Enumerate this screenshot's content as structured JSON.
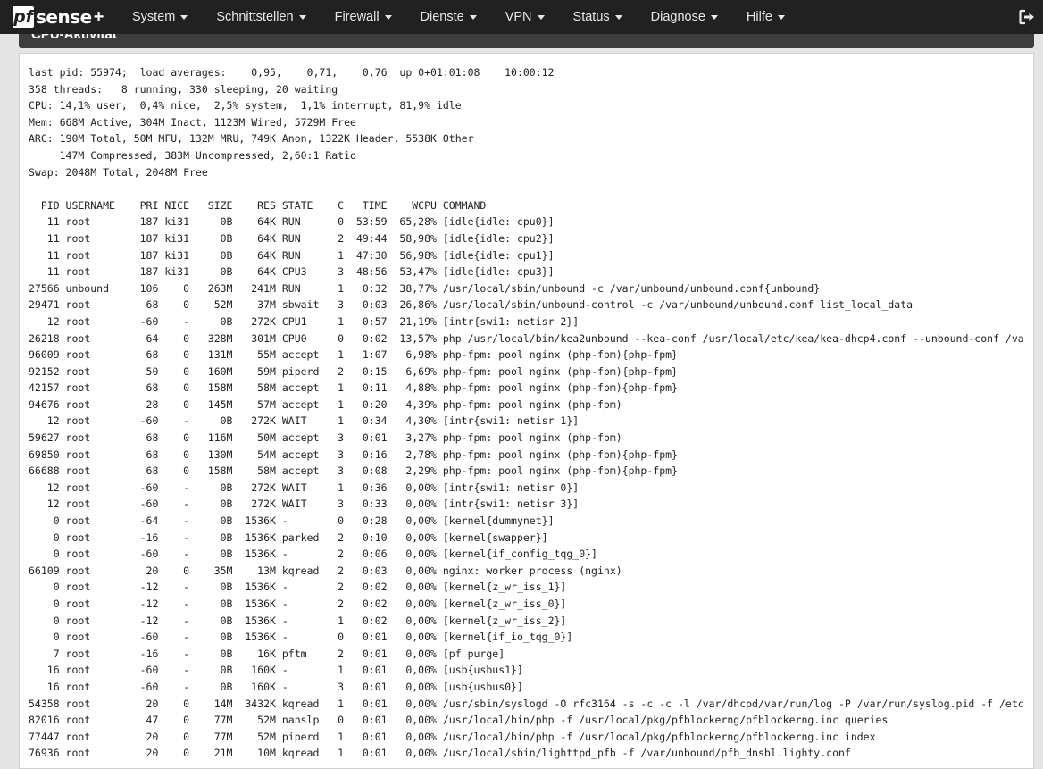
{
  "navbar": {
    "logo_mark": "pf",
    "logo_text": "sense",
    "logo_plus": "+",
    "menu": [
      "System",
      "Schnittstellen",
      "Firewall",
      "Dienste",
      "VPN",
      "Status",
      "Diagnose",
      "Hilfe"
    ]
  },
  "panel": {
    "title": "CPU-Aktivität"
  },
  "top_output": {
    "lines": [
      "last pid: 55974;  load averages:    0,95,    0,71,    0,76  up 0+01:01:08    10:00:12",
      "358 threads:   8 running, 330 sleeping, 20 waiting",
      "CPU: 14,1% user,  0,4% nice,  2,5% system,  1,1% interrupt, 81,9% idle",
      "Mem: 668M Active, 304M Inact, 1123M Wired, 5729M Free",
      "ARC: 190M Total, 50M MFU, 132M MRU, 749K Anon, 1322K Header, 5538K Other",
      "     147M Compressed, 383M Uncompressed, 2,60:1 Ratio",
      "Swap: 2048M Total, 2048M Free",
      "",
      "  PID USERNAME    PRI NICE   SIZE    RES STATE    C   TIME    WCPU COMMAND",
      "   11 root        187 ki31     0B    64K RUN      0  53:59  65,28% [idle{idle: cpu0}]",
      "   11 root        187 ki31     0B    64K RUN      2  49:44  58,98% [idle{idle: cpu2}]",
      "   11 root        187 ki31     0B    64K RUN      1  47:30  56,98% [idle{idle: cpu1}]",
      "   11 root        187 ki31     0B    64K CPU3     3  48:56  53,47% [idle{idle: cpu3}]",
      "27566 unbound     106    0   263M   241M RUN      1   0:32  38,77% /usr/local/sbin/unbound -c /var/unbound/unbound.conf{unbound}",
      "29471 root         68    0    52M    37M sbwait   3   0:03  26,86% /usr/local/sbin/unbound-control -c /var/unbound/unbound.conf list_local_data",
      "   12 root        -60    -     0B   272K CPU1     1   0:57  21,19% [intr{swi1: netisr 2}]",
      "26218 root         64    0   328M   301M CPU0     0   0:02  13,57% php /usr/local/bin/kea2unbound --kea-conf /usr/local/etc/kea/kea-dhcp4.conf --unbound-conf /va",
      "96009 root         68    0   131M    55M accept   1   1:07   6,98% php-fpm: pool nginx (php-fpm){php-fpm}",
      "92152 root         50    0   160M    59M piperd   2   0:15   6,69% php-fpm: pool nginx (php-fpm){php-fpm}",
      "42157 root         68    0   158M    58M accept   1   0:11   4,88% php-fpm: pool nginx (php-fpm){php-fpm}",
      "94676 root         28    0   145M    57M accept   1   0:20   4,39% php-fpm: pool nginx (php-fpm)",
      "   12 root        -60    -     0B   272K WAIT     1   0:34   4,30% [intr{swi1: netisr 1}]",
      "59627 root         68    0   116M    50M accept   3   0:01   3,27% php-fpm: pool nginx (php-fpm)",
      "69850 root         68    0   130M    54M accept   3   0:16   2,78% php-fpm: pool nginx (php-fpm){php-fpm}",
      "66688 root         68    0   158M    58M accept   3   0:08   2,29% php-fpm: pool nginx (php-fpm){php-fpm}",
      "   12 root        -60    -     0B   272K WAIT     1   0:36   0,00% [intr{swi1: netisr 0}]",
      "   12 root        -60    -     0B   272K WAIT     3   0:33   0,00% [intr{swi1: netisr 3}]",
      "    0 root        -64    -     0B  1536K -        0   0:28   0,00% [kernel{dummynet}]",
      "    0 root        -16    -     0B  1536K parked   2   0:10   0,00% [kernel{swapper}]",
      "    0 root        -60    -     0B  1536K -        2   0:06   0,00% [kernel{if_config_tqg_0}]",
      "66109 root         20    0    35M    13M kqread   2   0:03   0,00% nginx: worker process (nginx)",
      "    0 root        -12    -     0B  1536K -        2   0:02   0,00% [kernel{z_wr_iss_1}]",
      "    0 root        -12    -     0B  1536K -        2   0:02   0,00% [kernel{z_wr_iss_0}]",
      "    0 root        -12    -     0B  1536K -        1   0:02   0,00% [kernel{z_wr_iss_2}]",
      "    0 root        -60    -     0B  1536K -        0   0:01   0,00% [kernel{if_io_tqg_0}]",
      "    7 root        -16    -     0B    16K pftm     2   0:01   0,00% [pf purge]",
      "   16 root        -60    -     0B   160K -        1   0:01   0,00% [usb{usbus1}]",
      "   16 root        -60    -     0B   160K -        3   0:01   0,00% [usb{usbus0}]",
      "54358 root         20    0    14M  3432K kqread   1   0:01   0,00% /usr/sbin/syslogd -O rfc3164 -s -c -c -l /var/dhcpd/var/run/log -P /var/run/syslog.pid -f /etc",
      "82016 root         47    0    77M    52M nanslp   0   0:01   0,00% /usr/local/bin/php -f /usr/local/pkg/pfblockerng/pfblockerng.inc queries",
      "77447 root         20    0    77M    52M piperd   1   0:01   0,00% /usr/local/bin/php -f /usr/local/pkg/pfblockerng/pfblockerng.inc index",
      "76936 root         20    0    21M    10M kqread   1   0:01   0,00% /usr/local/sbin/lighttpd_pfb -f /var/unbound/pfb_dnsbl.lighty.conf"
    ]
  }
}
